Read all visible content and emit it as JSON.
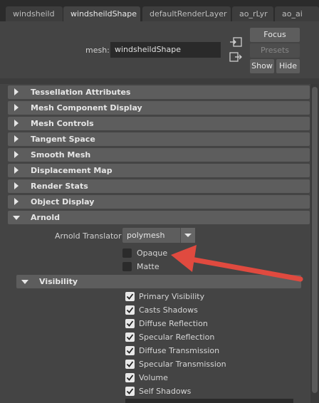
{
  "tabs": [
    "windsheild",
    "windsheildShape",
    "defaultRenderLayer",
    "ao_rLyr",
    "ao_ai"
  ],
  "active_tab": 1,
  "header": {
    "mesh_label": "mesh:",
    "mesh_value": "windsheildShape",
    "buttons": {
      "focus": "Focus",
      "presets": "Presets",
      "show": "Show",
      "hide": "Hide"
    }
  },
  "sections": [
    "Tessellation Attributes",
    "Mesh Component Display",
    "Mesh Controls",
    "Tangent Space",
    "Smooth Mesh",
    "Displacement Map",
    "Render Stats",
    "Object Display",
    "Arnold"
  ],
  "arnold": {
    "translator_label": "Arnold Translator",
    "translator_value": "polymesh",
    "opaque_label": "Opaque",
    "matte_label": "Matte",
    "visibility_section": "Visibility",
    "visibility_items": [
      "Primary Visibility",
      "Casts Shadows",
      "Diffuse Reflection",
      "Specular Reflection",
      "Diffuse Transmission",
      "Specular Transmission",
      "Volume",
      "Self Shadows"
    ]
  },
  "colors": {
    "annotation_arrow": "#e04a3f"
  }
}
